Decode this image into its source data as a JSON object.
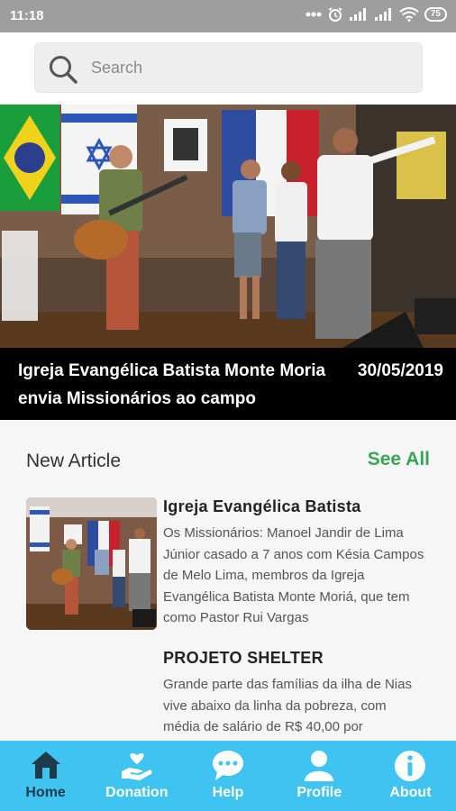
{
  "status_bar": {
    "time": "11:18",
    "battery": "75"
  },
  "search": {
    "placeholder": "Search"
  },
  "hero": {
    "title": "Igreja Evangélica  Batista Monte Moria envia Missionários ao campo",
    "date": "30/05/2019"
  },
  "new_article": {
    "heading": "New Article",
    "see_all": "See All",
    "articles": [
      {
        "title": "Igreja Evangélica  Batista",
        "text": "Os Missionários: Manoel Jandir de Lima Júnior casado a 7 anos com Késia Campos de Melo Lima, membros da Igreja Evangélica Batista Monte Moriá, que tem como Pastor Rui Vargas"
      },
      {
        "title": "PROJETO SHELTER",
        "text": "Grande parte das famílias da ilha de Nias vive abaixo da linha da pobreza, com média de salário de R$ 40,00 por"
      }
    ]
  },
  "nav": {
    "items": [
      {
        "label": "Home",
        "icon": "home-icon"
      },
      {
        "label": "Donation",
        "icon": "donation-icon"
      },
      {
        "label": "Help",
        "icon": "chat-icon"
      },
      {
        "label": "Profile",
        "icon": "user-icon"
      },
      {
        "label": "About",
        "icon": "info-icon"
      }
    ],
    "active": "Home"
  },
  "colors": {
    "nav_bg": "#3fc3f0",
    "see_all": "#3aa655",
    "status_bar": "#9e9e9e"
  }
}
